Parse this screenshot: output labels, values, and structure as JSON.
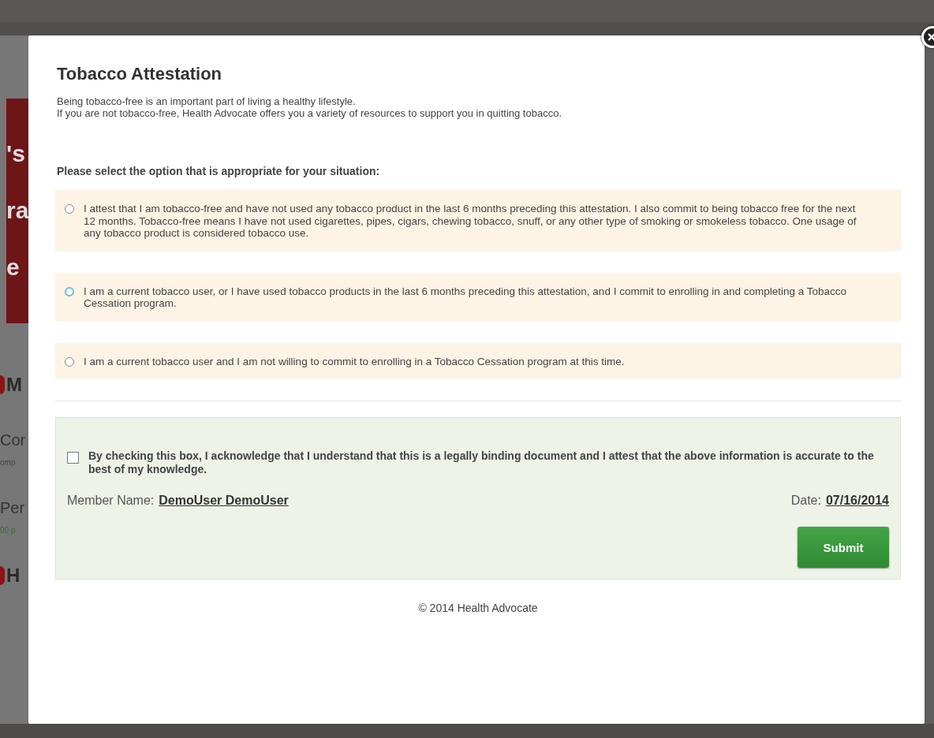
{
  "background_page": {
    "banner_fragments": [
      "'s",
      "ra",
      "e"
    ],
    "fragments": [
      {
        "text": "M",
        "kind": "heading"
      },
      {
        "text": "Cor",
        "kind": "text"
      },
      {
        "text": "omp",
        "kind": "subtext"
      },
      {
        "text": "Per",
        "kind": "text"
      },
      {
        "text": "00 p",
        "kind": "note"
      },
      {
        "text": "H",
        "kind": "heading"
      }
    ]
  },
  "dialog": {
    "title": "Tobacco Attestation",
    "intro": [
      "Being tobacco-free is an important part of living a healthy lifestyle.",
      "If you are not tobacco-free, Health Advocate offers you a variety of resources to support you in quitting tobacco."
    ],
    "prompt": "Please select the option that is appropriate for your situation:",
    "options": [
      {
        "label": "I attest that I am tobacco-free and have not used any tobacco product in the last 6 months preceding this attestation. I also commit to being tobacco free for the next 12 months. Tobacco-free means I have not used cigarettes, pipes, cigars, chewing tobacco, snuff, or any other type of smoking or smokeless tobacco. One usage of any tobacco product is considered tobacco use.",
        "selected": false,
        "focused": false
      },
      {
        "label": "I am a current tobacco user, or I have used tobacco products in the last 6 months preceding this attestation, and I commit to enrolling in and completing a Tobacco Cessation program.",
        "selected": false,
        "focused": true
      },
      {
        "label": "I am a current tobacco user and I am not willing to commit to enrolling in a Tobacco Cessation program at this time.",
        "selected": false,
        "focused": false
      }
    ],
    "acknowledgement": {
      "label": "By checking this box, I acknowledge that I understand that this is a legally binding document and I attest that the above information is accurate to the best of my knowledge.",
      "checked": false
    },
    "member_name": {
      "label": "Member Name:",
      "value": "DemoUser DemoUser"
    },
    "date": {
      "label": "Date:",
      "value": "07/16/2014"
    },
    "submit": "Submit",
    "footer": "© 2014 Health Advocate"
  }
}
